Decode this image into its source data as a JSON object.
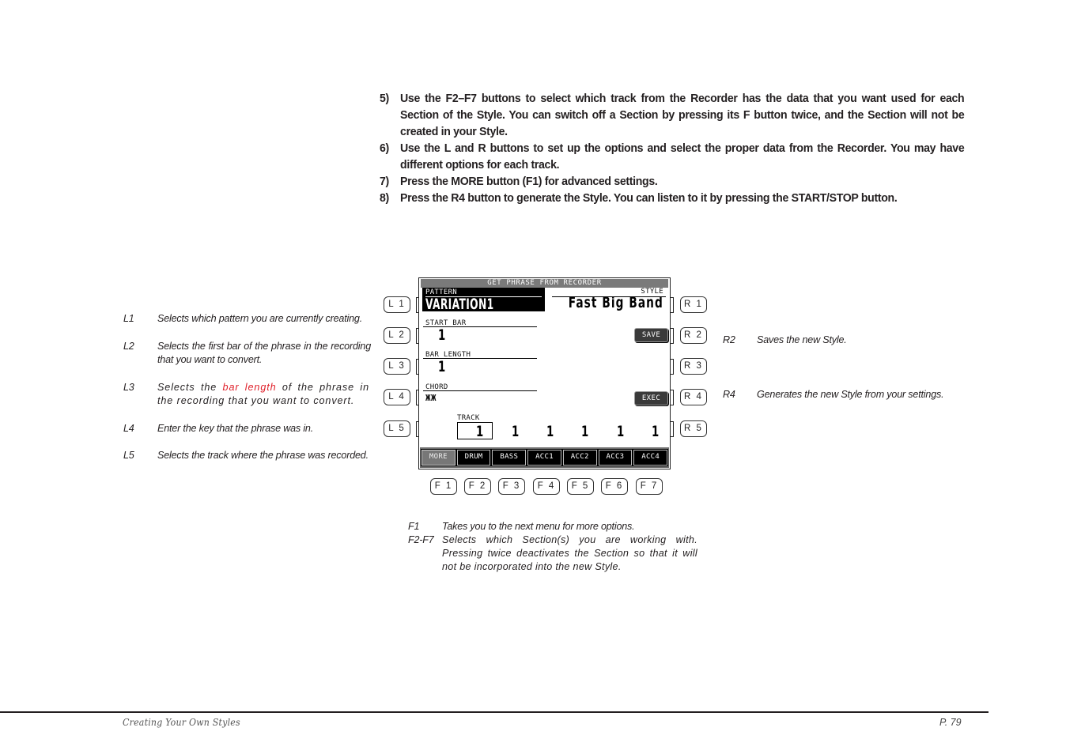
{
  "instructions": [
    {
      "num": "5)",
      "text": "Use the F2–F7 buttons to select which track from the Recorder has the data that you want used for each Section of the Style.  You can switch off a Section by pressing its F button twice, and the Section will not be created in your Style."
    },
    {
      "num": "6)",
      "text": "Use the L and R buttons to set up the options and select the proper data from the Recorder.  You may have different options for each track."
    },
    {
      "num": "7)",
      "text": "Press the MORE button (F1) for advanced settings."
    },
    {
      "num": "8)",
      "text": "Press the R4 button to generate the Style.  You can listen to it by pressing the START/STOP button."
    }
  ],
  "left_descriptions": [
    {
      "key": "L1",
      "text": "Selects which pattern you are currently creating."
    },
    {
      "key": "L2",
      "text": "Selects the first bar of the phrase in the recording that you want to convert."
    },
    {
      "key": "L3",
      "text_before": "Selects the ",
      "highlight": "bar length",
      "text_after": " of the phrase in the recording that you want to convert.",
      "highlight_color": "#e0202a"
    },
    {
      "key": "L4",
      "text": "Enter the key that the phrase was in."
    },
    {
      "key": "L5",
      "text": "Selects the track where the phrase was recorded."
    }
  ],
  "right_descriptions": [
    {
      "key": "R2",
      "text": "Saves the new Style."
    },
    {
      "key": "R4",
      "text": "Generates the new Style from your settings."
    }
  ],
  "f_descriptions": [
    {
      "key": "F1",
      "text": "Takes you to the next menu for more options."
    },
    {
      "key": "F2-F7",
      "text": "Selects which Section(s) you are working with.  Pressing twice deactivates the Section so that it will not be incorporated into the new Style."
    }
  ],
  "panel": {
    "left_buttons": [
      "L 1",
      "L 2",
      "L 3",
      "L 4",
      "L 5"
    ],
    "right_buttons": [
      "R 1",
      "R 2",
      "R 3",
      "R 4",
      "R 5"
    ],
    "f_buttons": [
      "F 1",
      "F 2",
      "F 3",
      "F 4",
      "F 5",
      "F 6",
      "F 7"
    ]
  },
  "screen": {
    "title": "GET PHRASE FROM RECORDER",
    "pattern_label": "PATTERN",
    "pattern_value": "VARIATION1",
    "style_label": "STYLE",
    "style_value": "Fast Big Band",
    "start_bar_label": "START BAR",
    "start_bar_value": "1",
    "bar_length_label": "BAR LENGTH",
    "bar_length_value": "1",
    "chord_label": "CHORD",
    "chord_value": "ЖЖ",
    "save_label": "SAVE",
    "exec_label": "EXEC",
    "track_label": "TRACK",
    "track_values": [
      "1",
      "1",
      "1",
      "1",
      "1",
      "1"
    ],
    "tabs": [
      "MORE",
      "DRUM",
      "BASS",
      "ACC1",
      "ACC2",
      "ACC3",
      "ACC4"
    ],
    "active_tab": "MORE"
  },
  "footer": {
    "section": "Creating Your Own Styles",
    "page": "P. 79"
  }
}
